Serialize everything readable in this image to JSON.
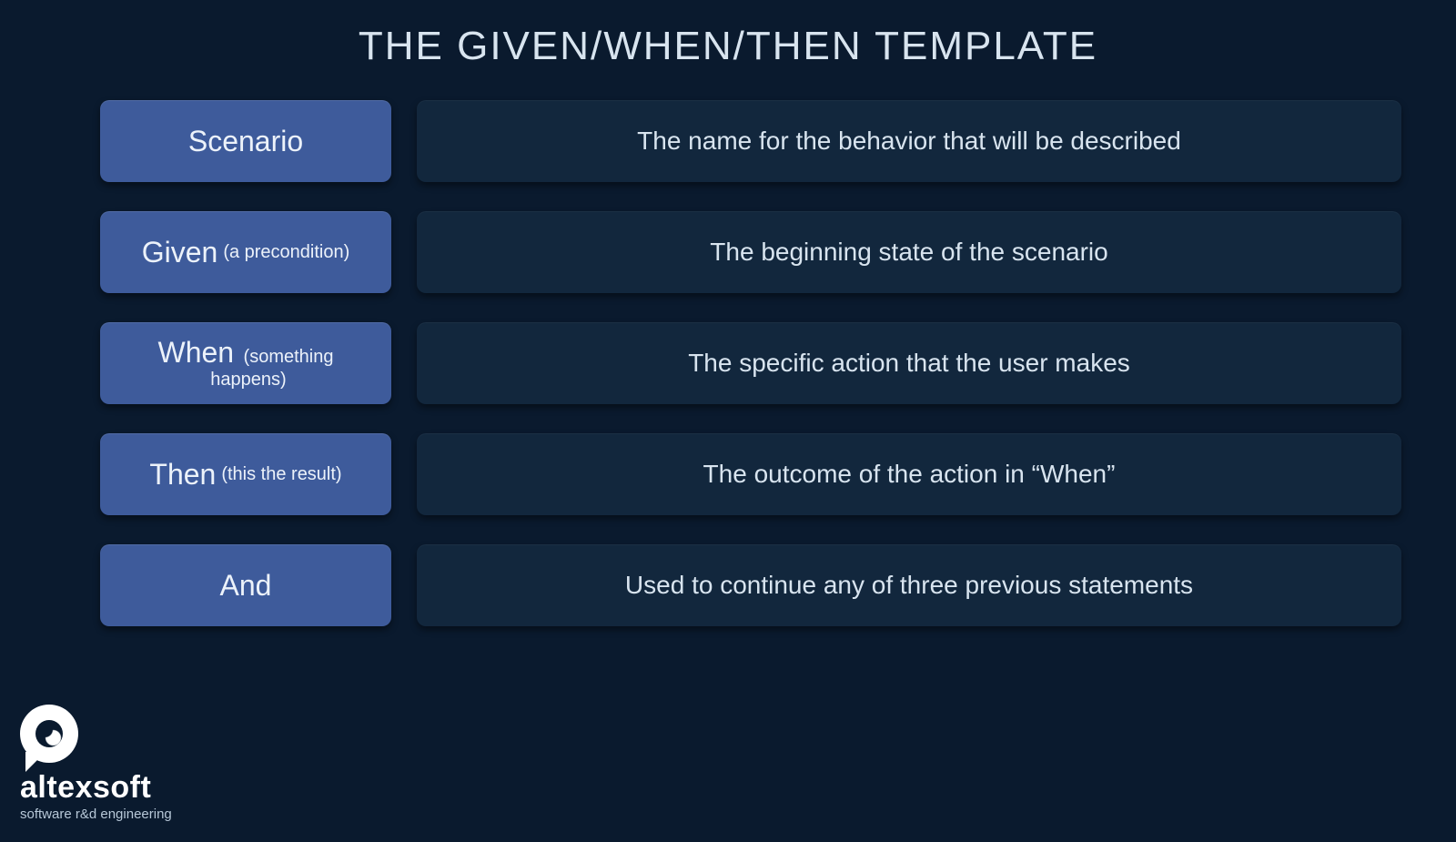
{
  "title": "THE GIVEN/WHEN/THEN TEMPLATE",
  "rows": [
    {
      "keyword": "Scenario",
      "note": "",
      "desc": "The name for the behavior that will be described"
    },
    {
      "keyword": "Given",
      "note": "(a precondition)",
      "desc": "The beginning state of the scenario"
    },
    {
      "keyword": "When",
      "note": "(something happens)",
      "desc": "The specific action that the user makes"
    },
    {
      "keyword": "Then",
      "note": "(this the result)",
      "desc": "The outcome of the action in “When”"
    },
    {
      "keyword": "And",
      "note": "",
      "desc": "Used to continue any of three previous statements"
    }
  ],
  "brand": {
    "name": "altexsoft",
    "tagline": "software r&d engineering"
  }
}
